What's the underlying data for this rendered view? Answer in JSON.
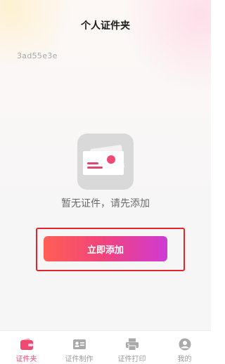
{
  "header": {
    "title": "个人证件夹"
  },
  "user": {
    "id": "3ad55e3e"
  },
  "empty_state": {
    "icon": "id-card-icon",
    "message": "暂无证件，请先添加"
  },
  "actions": {
    "add_now": "立即添加"
  },
  "colors": {
    "accent": "#ee4a74",
    "button_gradient": [
      "#fe5f55",
      "#f0427d",
      "#cf3bd6"
    ],
    "highlight_border": "#e0262c"
  },
  "tabbar": {
    "items": [
      {
        "label": "证件夹",
        "icon": "wallet-icon",
        "active": true
      },
      {
        "label": "证件制作",
        "icon": "id-card-icon",
        "active": false
      },
      {
        "label": "证件打印",
        "icon": "printer-icon",
        "active": false
      },
      {
        "label": "我的",
        "icon": "user-icon",
        "active": false
      }
    ]
  }
}
